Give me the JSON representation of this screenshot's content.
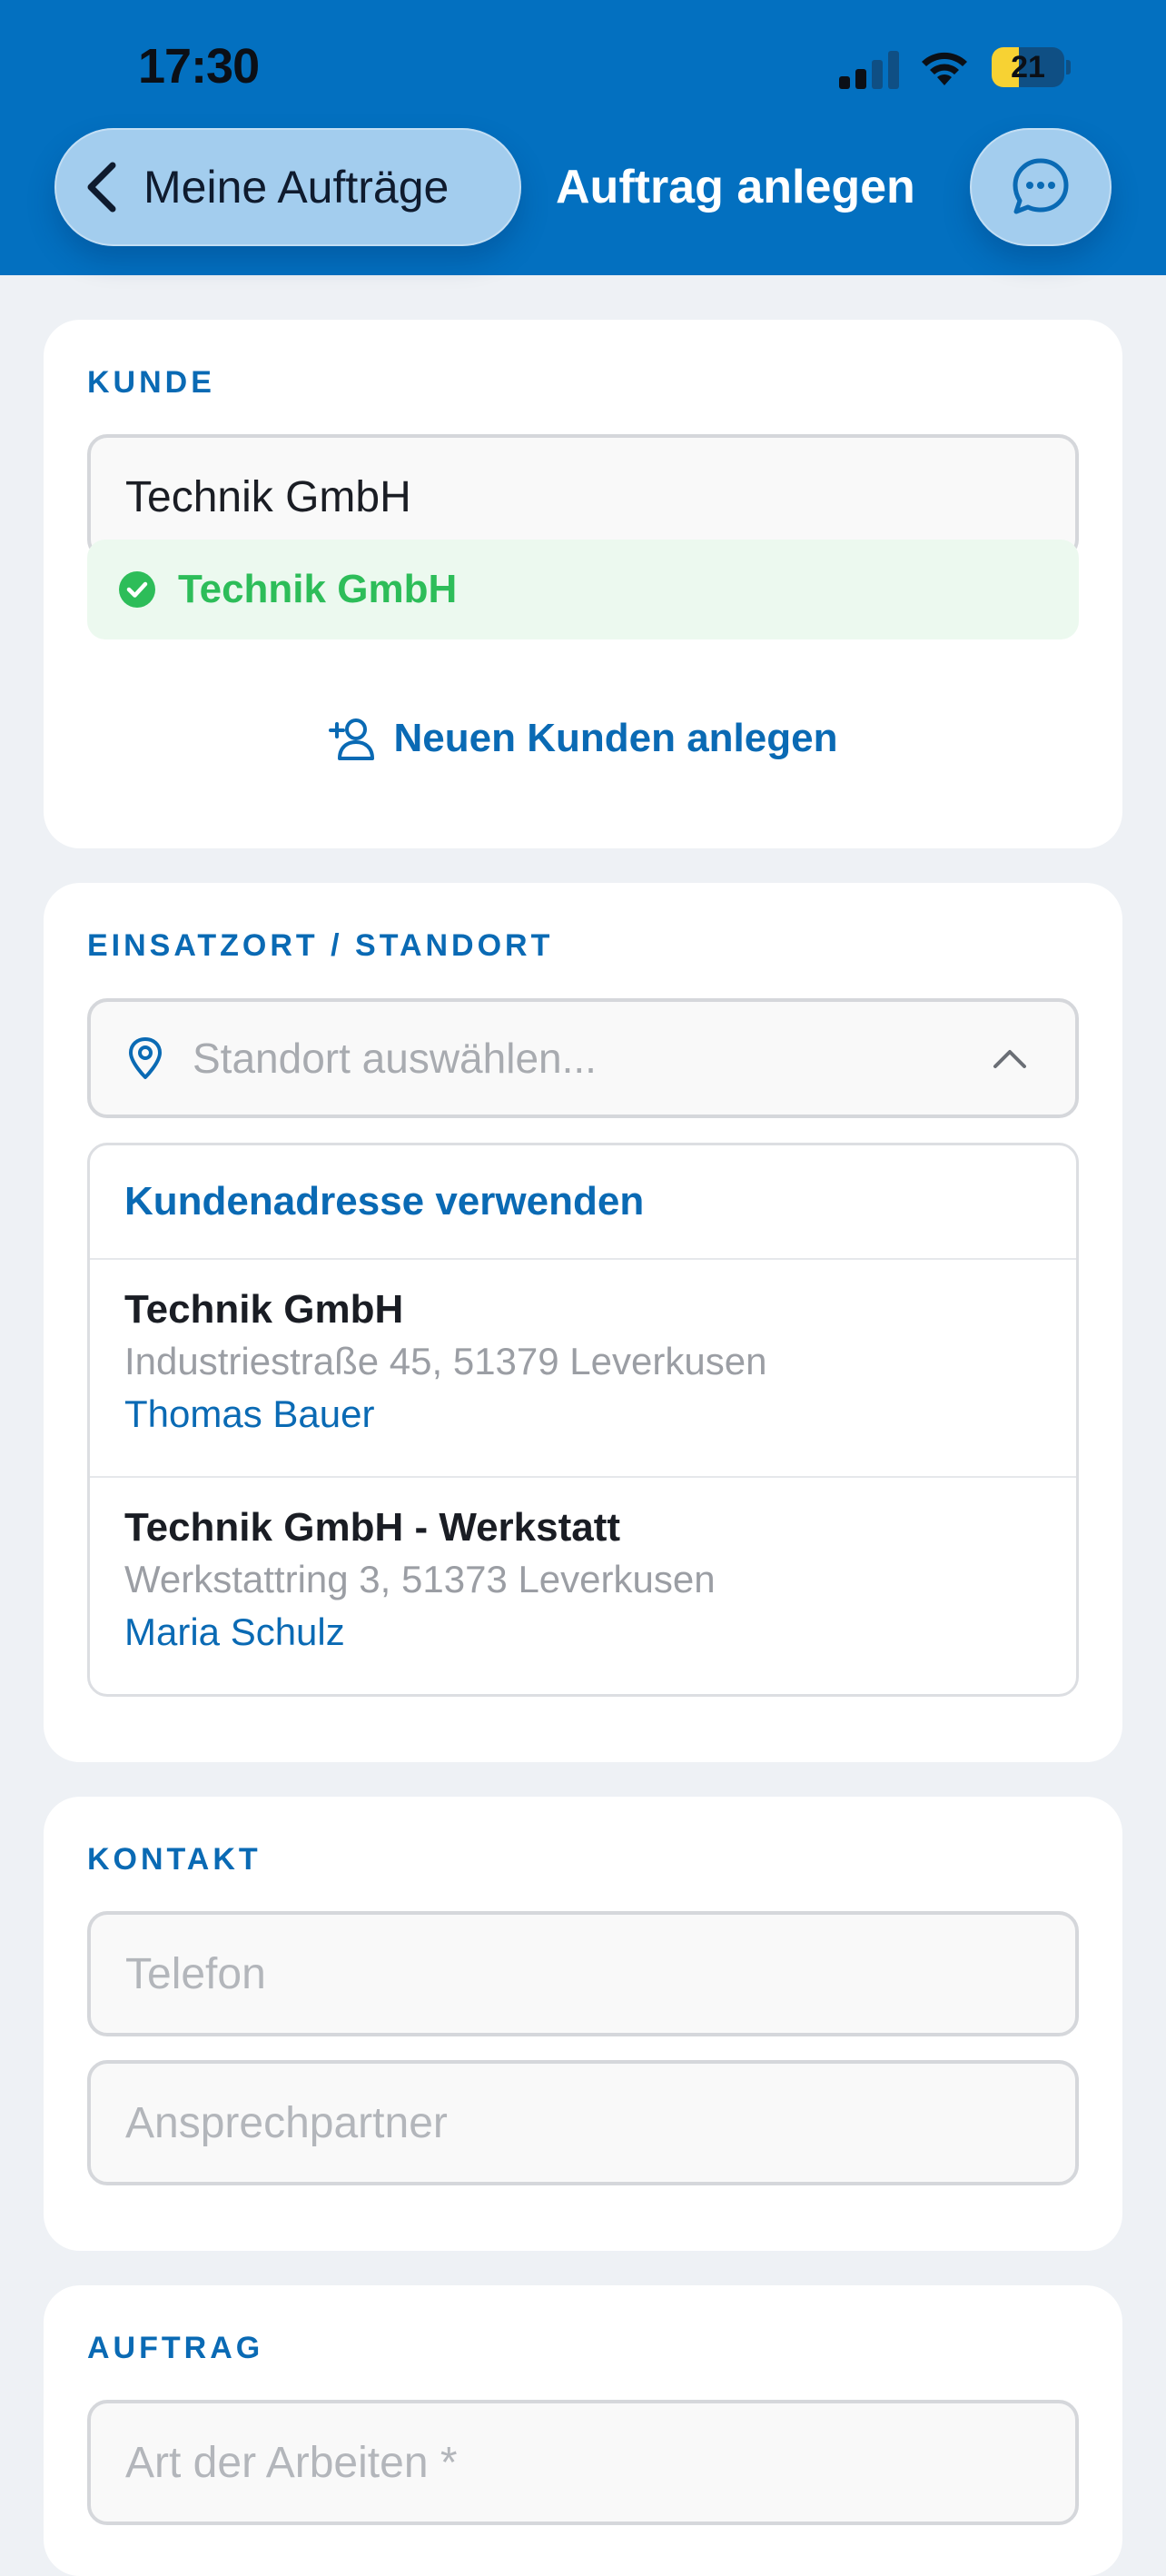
{
  "status_bar": {
    "time": "17:30",
    "battery": "21",
    "battery_level": 0.21
  },
  "header": {
    "back_label": "Meine Aufträge",
    "title": "Auftrag anlegen"
  },
  "kunde": {
    "label": "KUNDE",
    "input_value": "Technik GmbH",
    "selected": "Technik GmbH",
    "new_customer_label": "Neuen Kunden anlegen"
  },
  "standort": {
    "label": "EINSATZORT / STANDORT",
    "placeholder": "Standort auswählen...",
    "use_customer_address": "Kundenadresse verwenden",
    "options": [
      {
        "name": "Technik GmbH",
        "address": "Industriestraße 45, 51379 Leverkusen",
        "contact": "Thomas Bauer"
      },
      {
        "name": "Technik GmbH - Werkstatt",
        "address": "Werkstattring 3, 51373 Leverkusen",
        "contact": "Maria Schulz"
      }
    ]
  },
  "kontakt": {
    "label": "KONTAKT",
    "phone_placeholder": "Telefon",
    "contact_placeholder": "Ansprechpartner"
  },
  "auftrag": {
    "label": "AUFTRAG",
    "work_type_placeholder": "Art der Arbeiten *"
  },
  "colors": {
    "header_bg": "#0370c0",
    "accent": "#0a6ab4",
    "success": "#2dbd59",
    "success_bg": "#ecf9ef",
    "page_bg": "#eef1f5"
  },
  "icons": {
    "back": "chevron-left-icon",
    "chat": "chat-bubble-icon",
    "check": "check-circle-icon",
    "add_user": "add-user-icon",
    "location": "map-pin-icon",
    "collapse": "chevron-up-icon"
  }
}
